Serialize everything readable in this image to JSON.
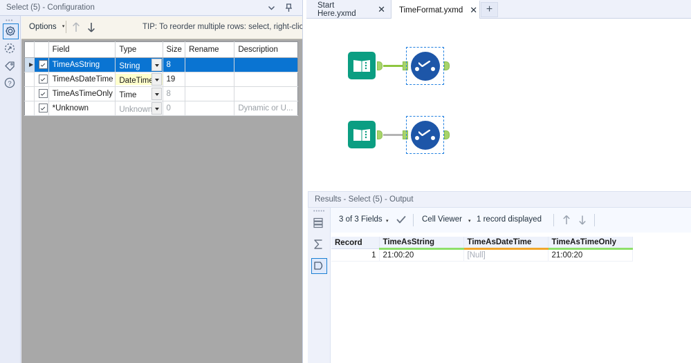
{
  "config_panel": {
    "title": "Select (5) - Configuration",
    "chevron_icon": "chevron-down-icon",
    "pin_icon": "pin-icon",
    "rail": [
      {
        "name": "gear-icon",
        "label": "Configuration",
        "active": true
      },
      {
        "name": "cycle-icon",
        "label": "Refresh",
        "active": false
      },
      {
        "name": "tag-icon",
        "label": "Annotation",
        "active": false
      },
      {
        "name": "help-icon",
        "label": "Help",
        "active": false
      }
    ],
    "toolbar": {
      "options_label": "Options",
      "caret": "▾",
      "move_up_icon": "arrow-up-icon",
      "move_down_icon": "arrow-down-icon",
      "tip": "TIP: To reorder multiple rows: select, right-click and drag."
    },
    "grid": {
      "headers": [
        "",
        "",
        "Field",
        "Type",
        "Size",
        "Rename",
        "Description"
      ],
      "rows": [
        {
          "pointer": "▶",
          "checked": true,
          "field": "TimeAsString",
          "type": "String",
          "type_highlighted": false,
          "type_muted": false,
          "size": "8",
          "rename": "",
          "description": "",
          "description_muted": false,
          "selected": true
        },
        {
          "pointer": "",
          "checked": true,
          "field": "TimeAsDateTime",
          "type": "DateTime",
          "type_highlighted": true,
          "type_muted": false,
          "size": "19",
          "rename": "",
          "description": "",
          "description_muted": false,
          "selected": false
        },
        {
          "pointer": "",
          "checked": true,
          "field": "TimeAsTimeOnly",
          "type": "Time",
          "type_highlighted": false,
          "type_muted": false,
          "size": "8",
          "rename": "",
          "description": "",
          "description_muted": false,
          "selected": false
        },
        {
          "pointer": "",
          "checked": true,
          "field": "*Unknown",
          "type": "Unknown",
          "type_highlighted": false,
          "type_muted": true,
          "size": "0",
          "rename": "",
          "description": "Dynamic or U...",
          "description_muted": true,
          "selected": false
        }
      ]
    }
  },
  "tabs": {
    "items": [
      {
        "label": "Start Here.yxmd",
        "active": false,
        "close_icon": "close-icon"
      },
      {
        "label": "TimeFormat.yxmd",
        "active": true,
        "close_icon": "close-icon"
      }
    ],
    "add_label": "+",
    "add_icon": "plus-icon"
  },
  "canvas": {
    "colors": {
      "input_tool": "#0b9e82",
      "select_tool": "#1d56a8",
      "port": "#a8d46a",
      "connector_active": "#8ec63f",
      "connector_inactive": "#b4b4b4",
      "selection_border": "#1f7fe0"
    },
    "nodes": [
      {
        "type": "input-tool",
        "icon": "book-icon",
        "connector": "active",
        "selected_downstream": true
      },
      {
        "type": "input-tool",
        "icon": "book-icon",
        "connector": "inactive",
        "selected_downstream": true
      }
    ],
    "select_tool_icon": "select-tool-icon"
  },
  "results": {
    "title": "Results - Select (5) - Output",
    "rail": [
      {
        "name": "rows-icon",
        "active": false
      },
      {
        "name": "sigma-icon",
        "active": false
      },
      {
        "name": "dataflow-icon",
        "active": true
      }
    ],
    "toolbar": {
      "fields_label": "3 of 3 Fields",
      "fields_caret": "▾",
      "check_icon": "checkmark-icon",
      "cellviewer_label": "Cell Viewer",
      "cellviewer_caret": "▾",
      "record_count": "1 record displayed",
      "prev_icon": "arrow-up-icon",
      "next_icon": "arrow-down-icon"
    },
    "grid": {
      "record_header": "Record",
      "columns": [
        {
          "label": "TimeAsString",
          "underline": "green"
        },
        {
          "label": "TimeAsDateTime",
          "underline": "orange"
        },
        {
          "label": "TimeAsTimeOnly",
          "underline": "green"
        }
      ],
      "rows": [
        {
          "record": "1",
          "cells": [
            {
              "value": "21:00:20",
              "null": false
            },
            {
              "value": "[Null]",
              "null": true
            },
            {
              "value": "21:00:20",
              "null": false
            }
          ]
        }
      ]
    }
  }
}
